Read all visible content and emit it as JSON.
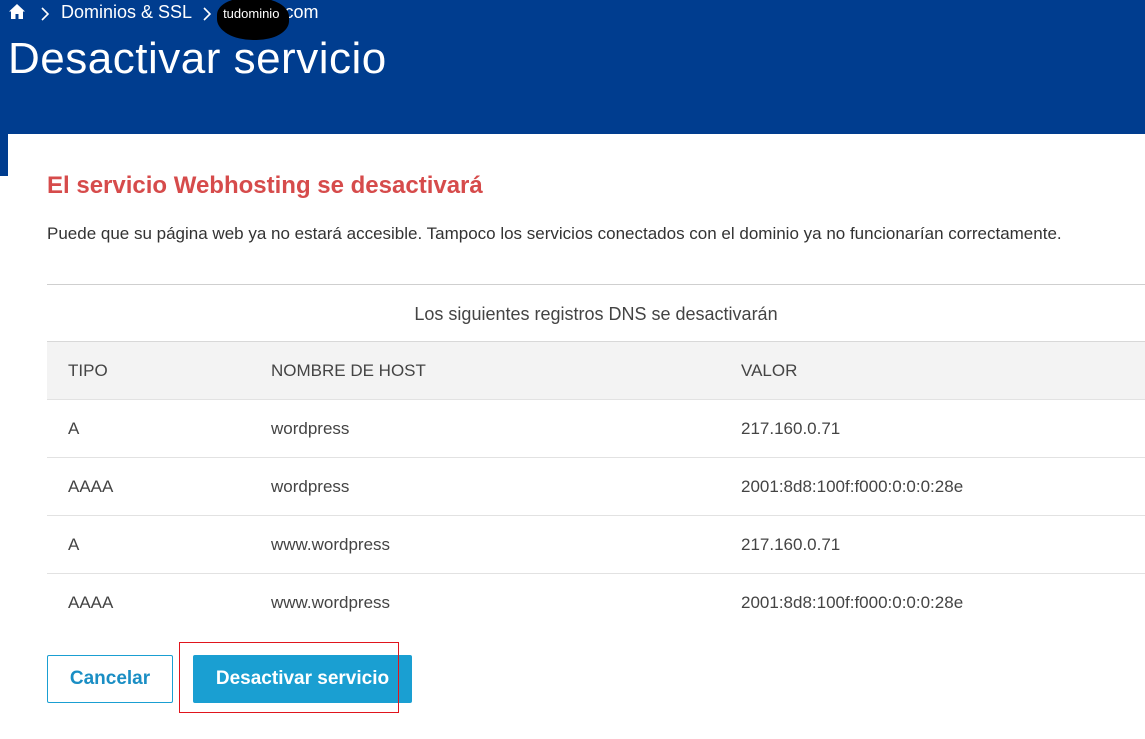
{
  "breadcrumb": {
    "home_icon": "home-icon",
    "section": "Dominios & SSL",
    "domain_redacted": "tudominio",
    "domain_suffix": ".com"
  },
  "page_title": "Desactivar servicio",
  "warning": {
    "title": "El servicio Webhosting se desactivará",
    "text": "Puede que su página web ya no estará accesible. Tampoco los servicios conectados con el dominio ya no funcionarían correctamente."
  },
  "dns_table": {
    "caption": "Los siguientes registros DNS se desactivarán",
    "headers": [
      "TIPO",
      "NOMBRE DE HOST",
      "VALOR"
    ],
    "rows": [
      [
        "A",
        "wordpress",
        "217.160.0.71"
      ],
      [
        "AAAA",
        "wordpress",
        "2001:8d8:100f:f000:0:0:0:28e"
      ],
      [
        "A",
        "www.wordpress",
        "217.160.0.71"
      ],
      [
        "AAAA",
        "www.wordpress",
        "2001:8d8:100f:f000:0:0:0:28e"
      ]
    ]
  },
  "buttons": {
    "cancel": "Cancelar",
    "deactivate": "Desactivar servicio"
  },
  "colors": {
    "header_bg": "#003d8f",
    "warning_title": "#d64b4b",
    "primary": "#1a9fd2",
    "highlight": "#e0151d"
  }
}
